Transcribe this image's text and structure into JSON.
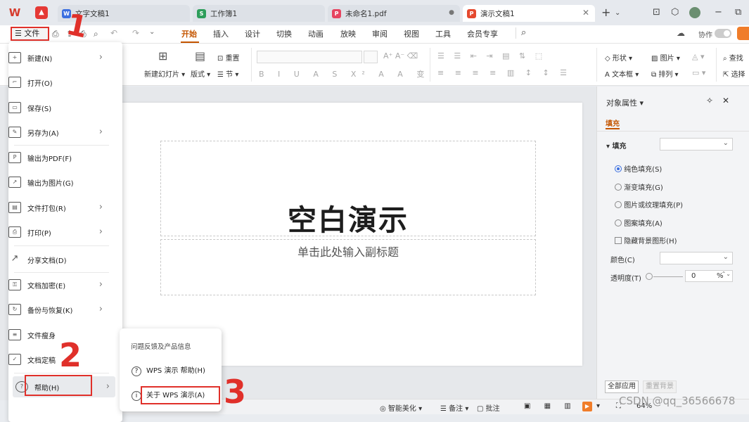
{
  "tabs": [
    {
      "label": "文字文稿1",
      "icon": "W",
      "color": "#3b6fe0"
    },
    {
      "label": "工作簿1",
      "icon": "S",
      "color": "#2e9e5b"
    },
    {
      "label": "未命名1.pdf",
      "icon": "P",
      "color": "#e64561"
    },
    {
      "label": "演示文稿1",
      "icon": "P",
      "color": "#e5492e"
    }
  ],
  "app_logo": "W",
  "menu": {
    "file_label": "文件",
    "items": [
      "开始",
      "插入",
      "设计",
      "切换",
      "动画",
      "放映",
      "审阅",
      "视图",
      "工具",
      "会员专享"
    ],
    "active": "开始",
    "collab_label": "协作"
  },
  "ribbon": {
    "new_slide": "新建幻灯片",
    "layout": "版式",
    "section": "节",
    "reset": "重置",
    "shape": "形状",
    "picture": "图片",
    "textbox": "文本框",
    "arrange": "排列",
    "find": "查找",
    "select": "选择"
  },
  "file_menu": {
    "items": [
      {
        "label": "新建(N)",
        "icon": "new-icon",
        "has_sub": true
      },
      {
        "label": "打开(O)",
        "icon": "open-folder-icon",
        "has_sub": false
      },
      {
        "label": "保存(S)",
        "icon": "save-icon",
        "has_sub": false
      },
      {
        "label": "另存为(A)",
        "icon": "save-as-icon",
        "has_sub": true
      },
      {
        "label": "输出为PDF(F)",
        "icon": "pdf-export-icon",
        "has_sub": false
      },
      {
        "label": "输出为图片(G)",
        "icon": "image-export-icon",
        "has_sub": false
      },
      {
        "label": "文件打包(R)",
        "icon": "package-icon",
        "has_sub": true
      },
      {
        "label": "打印(P)",
        "icon": "print-icon",
        "has_sub": true
      },
      {
        "label": "分享文档(D)",
        "icon": "share-icon",
        "has_sub": false
      },
      {
        "label": "文档加密(E)",
        "icon": "encrypt-icon",
        "has_sub": true
      },
      {
        "label": "备份与恢复(K)",
        "icon": "backup-icon",
        "has_sub": true
      },
      {
        "label": "文件瘦身",
        "icon": "slim-icon",
        "has_sub": false
      },
      {
        "label": "文档定稿",
        "icon": "finalize-icon",
        "has_sub": false
      },
      {
        "label": "帮助(H)",
        "icon": "help-icon",
        "has_sub": true
      }
    ]
  },
  "help_submenu": {
    "heading": "问题反馈及产品信息",
    "items": [
      "WPS 演示 帮助(H)",
      "关于 WPS 演示(A)"
    ]
  },
  "slide": {
    "title": "空白演示",
    "subtitle": "单击此处输入副标题"
  },
  "panel": {
    "title": "对象属性",
    "tab": "填充",
    "section": "填充",
    "options": [
      "纯色填充(S)",
      "渐变填充(G)",
      "图片或纹理填充(P)",
      "图案填充(A)"
    ],
    "hide_bg": "隐藏背景图形(H)",
    "color_label": "颜色(C)",
    "transparency_label": "透明度(T)",
    "transparency_value": "0",
    "transparency_unit": "%",
    "apply_all": "全部应用",
    "reset_bg": "重置背景"
  },
  "statusbar": {
    "smart": "智能美化",
    "notes": "备注",
    "comments": "批注",
    "zoom": "64%"
  },
  "annotations": [
    "1",
    "2",
    "3"
  ],
  "watermark": "CSDN @qq_36566678"
}
